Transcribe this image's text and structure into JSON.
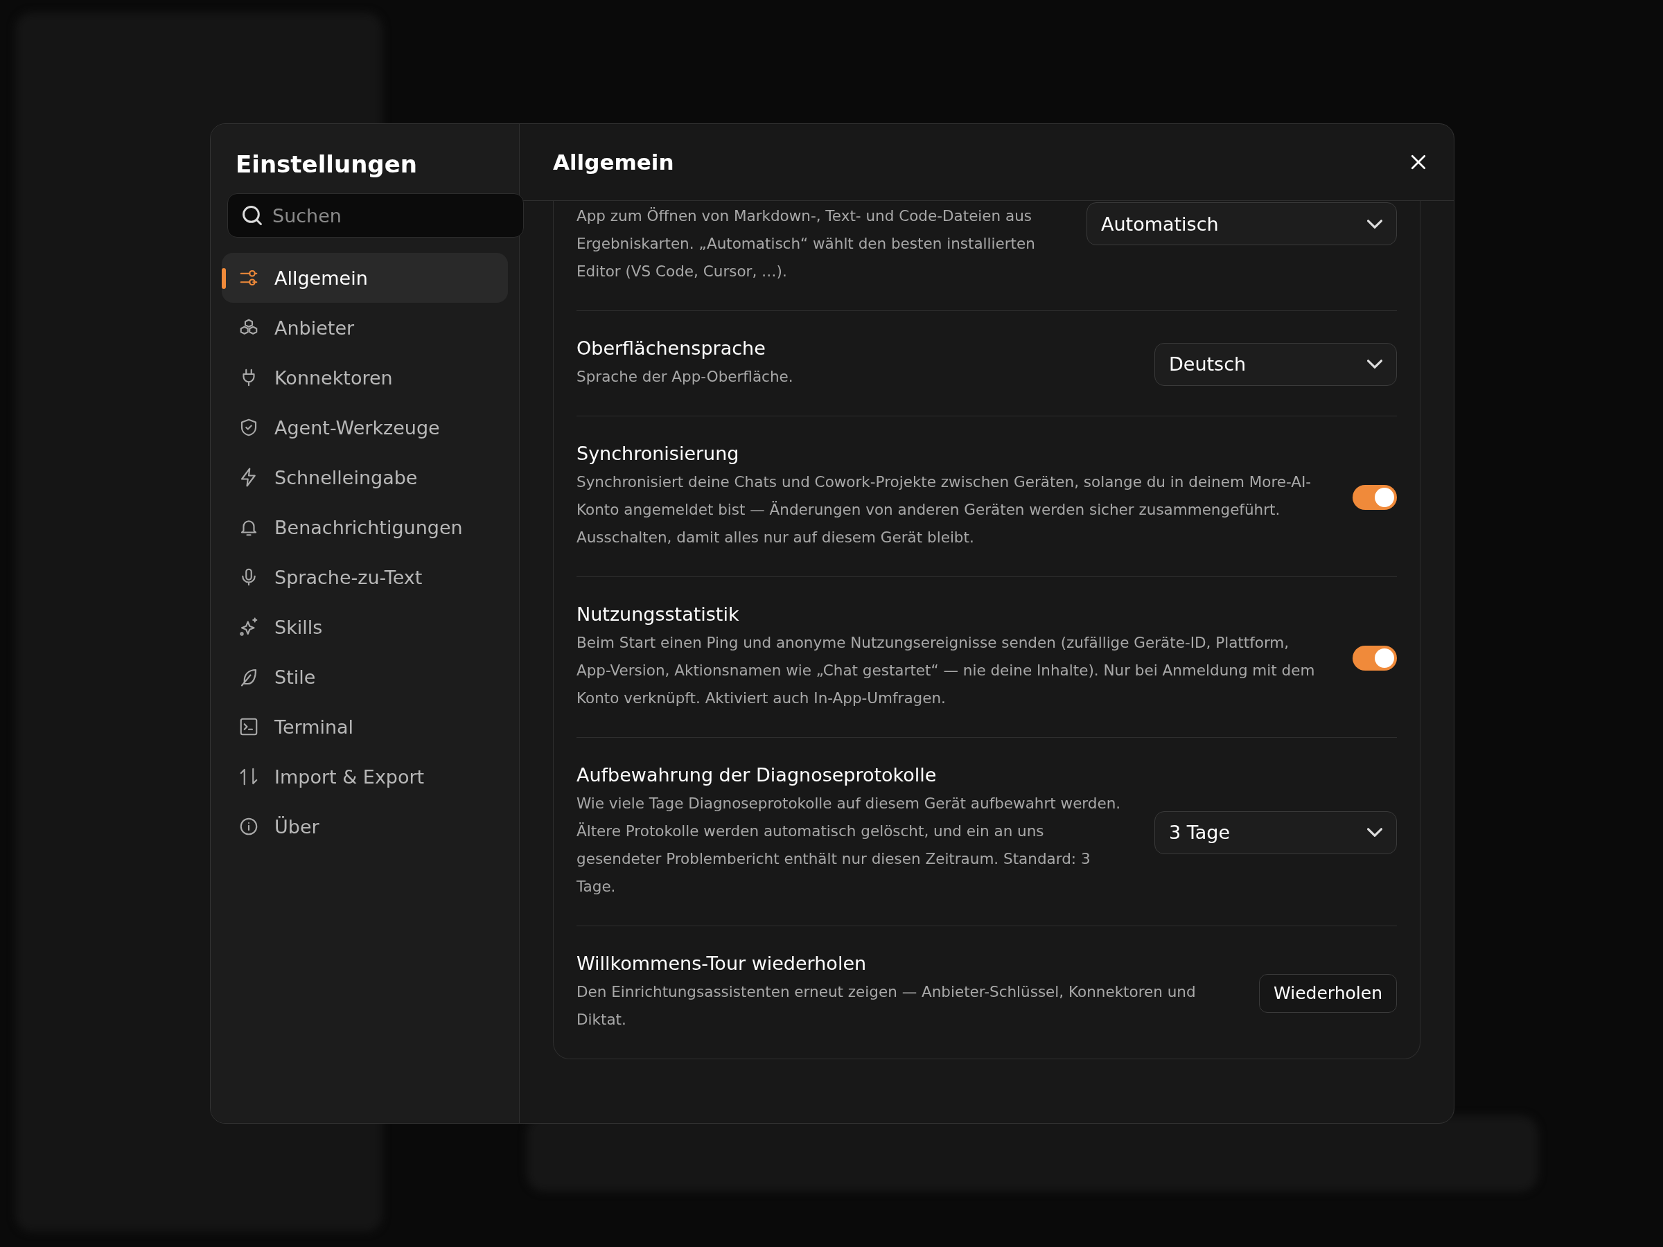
{
  "sidebar": {
    "title": "Einstellungen",
    "search": {
      "placeholder": "Suchen"
    },
    "items": [
      {
        "label": "Allgemein",
        "selected": true
      },
      {
        "label": "Anbieter",
        "selected": false
      },
      {
        "label": "Konnektoren",
        "selected": false
      },
      {
        "label": "Agent-Werkzeuge",
        "selected": false
      },
      {
        "label": "Schnelleingabe",
        "selected": false
      },
      {
        "label": "Benachrichtigungen",
        "selected": false
      },
      {
        "label": "Sprache-zu-Text",
        "selected": false
      },
      {
        "label": "Skills",
        "selected": false
      },
      {
        "label": "Stile",
        "selected": false
      },
      {
        "label": "Terminal",
        "selected": false
      },
      {
        "label": "Import & Export",
        "selected": false
      },
      {
        "label": "Über",
        "selected": false
      }
    ]
  },
  "panel": {
    "title": "Allgemein",
    "settings": [
      {
        "kind": "select",
        "description": "App zum Öffnen von Markdown-, Text- und Code-Dateien aus Ergebniskarten. „Automatisch“ wählt den besten installierten Editor (VS Code, Cursor, …).",
        "value": "Automatisch"
      },
      {
        "kind": "select",
        "title": "Oberflächensprache",
        "description": "Sprache der App-Oberfläche.",
        "value": "Deutsch"
      },
      {
        "kind": "toggle",
        "title": "Synchronisierung",
        "description": "Synchronisiert deine Chats und Cowork-Projekte zwischen Geräten, solange du in deinem More-AI-Konto angemeldet bist — Änderungen von anderen Geräten werden sicher zusammengeführt. Ausschalten, damit alles nur auf diesem Gerät bleibt.",
        "on": true
      },
      {
        "kind": "toggle",
        "title": "Nutzungsstatistik",
        "description": "Beim Start einen Ping und anonyme Nutzungsereignisse senden (zufällige Geräte-ID, Plattform, App-Version, Aktionsnamen wie „Chat gestartet“ — nie deine Inhalte). Nur bei Anmeldung mit dem Konto verknüpft. Aktiviert auch In-App-Umfragen.",
        "on": true
      },
      {
        "kind": "select",
        "title": "Aufbewahrung der Diagnoseprotokolle",
        "description": "Wie viele Tage Diagnoseprotokolle auf diesem Gerät aufbewahrt werden. Ältere Protokolle werden automatisch gelöscht, und ein an uns gesendeter Problembericht enthält nur diesen Zeitraum. Standard: 3 Tage.",
        "value": "3 Tage"
      },
      {
        "kind": "button",
        "title": "Willkommens-Tour wiederholen",
        "description": "Den Einrichtungsassistenten erneut zeigen — Anbieter-Schlüssel, Konnektoren und Diktat.",
        "value": "Wiederholen"
      }
    ]
  }
}
